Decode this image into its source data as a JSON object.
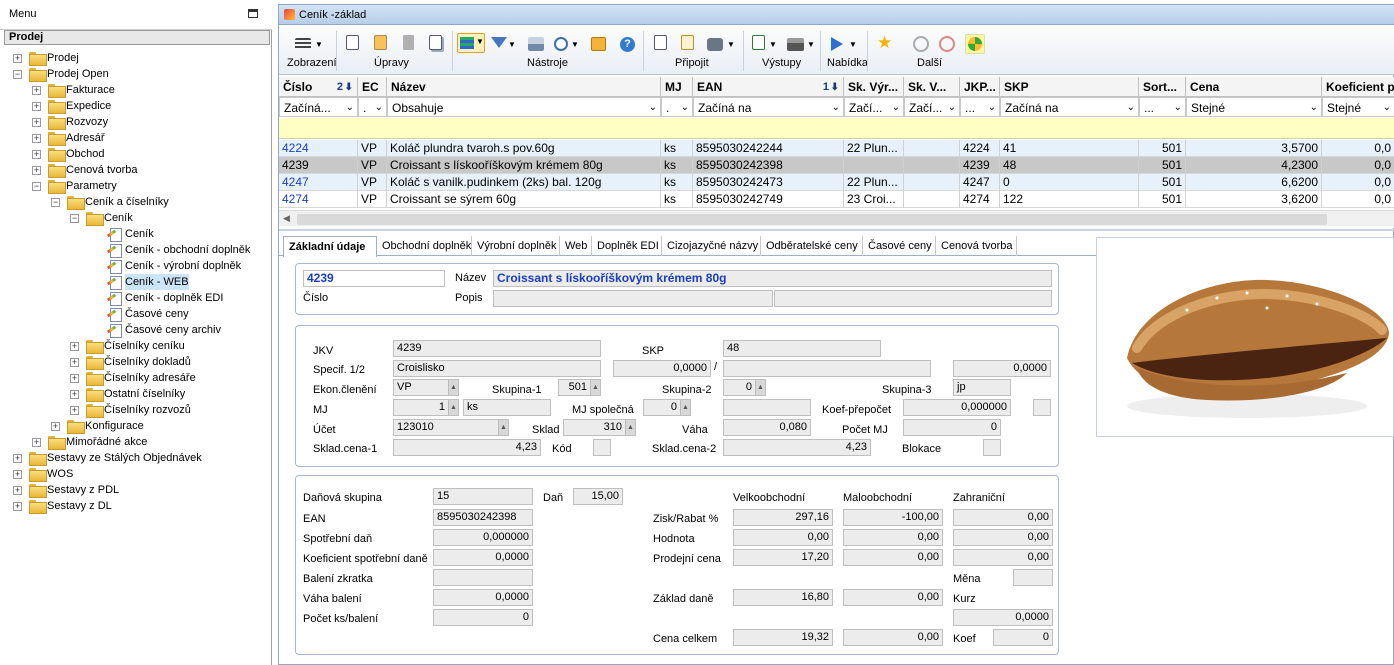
{
  "menu": {
    "title": "Menu",
    "section": "Prodej",
    "tree": [
      {
        "label": "Prodej",
        "level": 0,
        "type": "folder",
        "exp": "+"
      },
      {
        "label": "Prodej Open",
        "level": 0,
        "type": "folder",
        "exp": "-"
      },
      {
        "label": "Fakturace",
        "level": 1,
        "type": "folder",
        "exp": "+"
      },
      {
        "label": "Expedice",
        "level": 1,
        "type": "folder",
        "exp": "+"
      },
      {
        "label": "Rozvozy",
        "level": 1,
        "type": "folder",
        "exp": "+"
      },
      {
        "label": "Adresář",
        "level": 1,
        "type": "folder",
        "exp": "+"
      },
      {
        "label": "Obchod",
        "level": 1,
        "type": "folder",
        "exp": "+"
      },
      {
        "label": "Cenová tvorba",
        "level": 1,
        "type": "folder",
        "exp": "+"
      },
      {
        "label": "Parametry",
        "level": 1,
        "type": "folder",
        "exp": "-"
      },
      {
        "label": "Ceník a číselníky",
        "level": 2,
        "type": "folder",
        "exp": "-"
      },
      {
        "label": "Ceník",
        "level": 3,
        "type": "folder",
        "exp": "-"
      },
      {
        "label": "Ceník",
        "level": 4,
        "type": "doc",
        "exp": ""
      },
      {
        "label": "Ceník - obchodní doplněk",
        "level": 4,
        "type": "doc",
        "exp": ""
      },
      {
        "label": "Ceník - výrobní doplněk",
        "level": 4,
        "type": "doc",
        "exp": ""
      },
      {
        "label": "Ceník - WEB",
        "level": 4,
        "type": "doc",
        "exp": "",
        "selected": true
      },
      {
        "label": "Ceník - doplněk EDI",
        "level": 4,
        "type": "doc",
        "exp": ""
      },
      {
        "label": "Časové ceny",
        "level": 4,
        "type": "doc",
        "exp": ""
      },
      {
        "label": "Časové ceny archiv",
        "level": 4,
        "type": "doc",
        "exp": ""
      },
      {
        "label": "Číselníky ceníku",
        "level": 3,
        "type": "folder",
        "exp": "+"
      },
      {
        "label": "Číselníky dokladů",
        "level": 3,
        "type": "folder",
        "exp": "+"
      },
      {
        "label": "Číselníky adresáře",
        "level": 3,
        "type": "folder",
        "exp": "+"
      },
      {
        "label": "Ostatní číselníky",
        "level": 3,
        "type": "folder",
        "exp": "+"
      },
      {
        "label": "Číselníky rozvozů",
        "level": 3,
        "type": "folder",
        "exp": "+"
      },
      {
        "label": "Konfigurace",
        "level": 2,
        "type": "folder",
        "exp": "+"
      },
      {
        "label": "Mimořádné akce",
        "level": 1,
        "type": "folder",
        "exp": "+"
      },
      {
        "label": "Sestavy ze Stálých Objednávek",
        "level": 0,
        "type": "folder",
        "exp": "+"
      },
      {
        "label": "WOS",
        "level": 0,
        "type": "folder",
        "exp": "+"
      },
      {
        "label": "Sestavy z PDL",
        "level": 0,
        "type": "folder",
        "exp": "+"
      },
      {
        "label": "Sestavy z DL",
        "level": 0,
        "type": "folder",
        "exp": "+"
      }
    ]
  },
  "window": {
    "title": "Ceník -základ",
    "toolbar_groups": [
      "Zobrazení",
      "Úpravy",
      "Nástroje",
      "Připojit",
      "Výstupy",
      "Nabídka",
      "Další"
    ]
  },
  "grid": {
    "columns": [
      {
        "h": "Číslo",
        "f": "Začíná...",
        "sort": "2"
      },
      {
        "h": "EC",
        "f": "."
      },
      {
        "h": "Název",
        "f": "Obsahuje"
      },
      {
        "h": "MJ",
        "f": "."
      },
      {
        "h": "EAN",
        "f": "Začíná na",
        "sort": "1"
      },
      {
        "h": "Sk. Výr...",
        "f": "Začí..."
      },
      {
        "h": "Sk. V...",
        "f": "Začí..."
      },
      {
        "h": "JKP...",
        "f": "..."
      },
      {
        "h": "SKP",
        "f": "Začíná na"
      },
      {
        "h": "Sort...",
        "f": "..."
      },
      {
        "h": "Cena",
        "f": "Stejné"
      },
      {
        "h": "Koeficient p",
        "f": "Stejné"
      }
    ],
    "rows": [
      {
        "cislo": "4224",
        "ec": "VP",
        "nazev": "Koláč plundra tvaroh.s pov.60g",
        "mj": "ks",
        "ean": "8595030242244",
        "skvyr": "22 Plun...",
        "skv": "",
        "jkp": "4224",
        "skp": "41",
        "sort": "501",
        "cena": "3,5700",
        "koef": "0,0"
      },
      {
        "cislo": "4239",
        "ec": "VP",
        "nazev": "Croissant s lískooříškovým krémem  80g",
        "mj": "ks",
        "ean": "8595030242398",
        "skvyr": "",
        "skv": "",
        "jkp": "4239",
        "skp": "48",
        "sort": "501",
        "cena": "4,2300",
        "koef": "0,0"
      },
      {
        "cislo": "4247",
        "ec": "VP",
        "nazev": "Koláč s vanilk.pudinkem (2ks) bal. 120g",
        "mj": "ks",
        "ean": "8595030242473",
        "skvyr": "22 Plun...",
        "skv": "",
        "jkp": "4247",
        "skp": "0",
        "sort": "501",
        "cena": "6,6200",
        "koef": "0,0"
      },
      {
        "cislo": "4274",
        "ec": "VP",
        "nazev": "Croissant se sýrem  60g",
        "mj": "ks",
        "ean": "8595030242749",
        "skvyr": "23 Croi...",
        "skv": "",
        "jkp": "4274",
        "skp": "122",
        "sort": "501",
        "cena": "3,6200",
        "koef": "0,0"
      }
    ]
  },
  "tabs": [
    "Základní údaje",
    "Obchodní doplněk",
    "Výrobní doplněk",
    "Web",
    "Doplněk EDI",
    "Cizojazyčné názvy",
    "Odběratelské ceny",
    "Časové ceny",
    "Cenová tvorba"
  ],
  "detail": {
    "cislo_val": "4239",
    "cislo_lbl": "Číslo",
    "nazev_lbl": "Název",
    "nazev_val": "Croissant s lískooříškovým krémem  80g",
    "popis_lbl": "Popis",
    "jkv_lbl": "JKV",
    "jkv_val": "4239",
    "skp_lbl": "SKP",
    "skp_val": "48",
    "specif_lbl": "Specif. 1/2",
    "specif_val": "Croislisko",
    "specif_num": "0,0000",
    "slash": "/",
    "specif_num2": "0,0000",
    "ekon_lbl": "Ekon.členění",
    "ekon_val": "VP",
    "sk1_lbl": "Skupina-1",
    "sk1_val": "501",
    "sk2_lbl": "Skupina-2",
    "sk2_val": "0",
    "sk3_lbl": "Skupina-3",
    "sk3_val": "jp",
    "mj_lbl": "MJ",
    "mj_num": "1",
    "mj_val": "ks",
    "mjs_lbl": "MJ společná",
    "mjs_val": "0",
    "koefp_lbl": "Koef-přepočet",
    "koefp_val": "0,000000",
    "ucet_lbl": "Účet",
    "ucet_val": "123010",
    "sklad_lbl": "Sklad",
    "sklad_val": "310",
    "vaha_lbl": "Váha",
    "vaha_val": "0,080",
    "pmj_lbl": "Počet MJ",
    "pmj_val": "0",
    "sc1_lbl": "Sklad.cena-1",
    "sc1_val": "4,23",
    "kod_lbl": "Kód",
    "sc2_lbl": "Sklad.cena-2",
    "sc2_val": "4,23",
    "blok_lbl": "Blokace",
    "dsk_lbl": "Daňová skupina",
    "dsk_val": "15",
    "dan_lbl": "Daň",
    "dan_val": "15,00",
    "ean_lbl": "EAN",
    "ean_val": "8595030242398",
    "sd_lbl": "Spotřební daň",
    "sd_val": "0,000000",
    "ksd_lbl": "Koeficient spotřební daně",
    "ksd_val": "0,0000",
    "bz_lbl": "Balení zkratka",
    "vb_lbl": "Váha balení",
    "vb_val": "0,0000",
    "pks_lbl": "Počet ks/balení",
    "pks_val": "0",
    "vo_lbl": "Velkoobchodní",
    "mo_lbl": "Maloobchodní",
    "za_lbl": "Zahraniční",
    "zr_lbl": "Zisk/Rabat %",
    "zr_vo": "297,16",
    "zr_mo": "-100,00",
    "zr_za": "0,00",
    "ho_lbl": "Hodnota",
    "ho_vo": "0,00",
    "ho_mo": "0,00",
    "ho_za": "0,00",
    "pc_lbl": "Prodejní cena",
    "pc_vo": "17,20",
    "pc_mo": "0,00",
    "pc_za": "0,00",
    "mena_lbl": "Měna",
    "zd_lbl": "Základ daně",
    "zd_vo": "16,80",
    "zd_mo": "0,00",
    "kurz_lbl": "Kurz",
    "kurz_val": "0,0000",
    "cc_lbl": "Cena celkem",
    "cc_vo": "19,32",
    "cc_mo": "0,00",
    "koef_lbl": "Koef",
    "koef_val": "0"
  }
}
